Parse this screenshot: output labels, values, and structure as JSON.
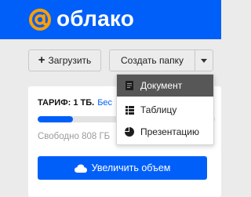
{
  "brand": {
    "name": "облако",
    "logo_icon": "at-sign-icon",
    "accent": "#005ff9",
    "logo_color": "#ff9e00"
  },
  "toolbar": {
    "upload_label": "Загрузить",
    "create_folder_label": "Создать папку"
  },
  "create_menu": {
    "items": [
      {
        "label": "Документ",
        "icon": "document-icon",
        "active": true
      },
      {
        "label": "Таблицу",
        "icon": "table-icon",
        "active": false
      },
      {
        "label": "Презентацию",
        "icon": "presentation-icon",
        "active": false
      }
    ]
  },
  "tariff": {
    "title": "ТАРИФ: 1 ТБ.",
    "link": "Бес",
    "usage_fraction": 0.2,
    "free_text": "Свободно 808 ГБ",
    "increase_label": "Увеличить объем"
  }
}
